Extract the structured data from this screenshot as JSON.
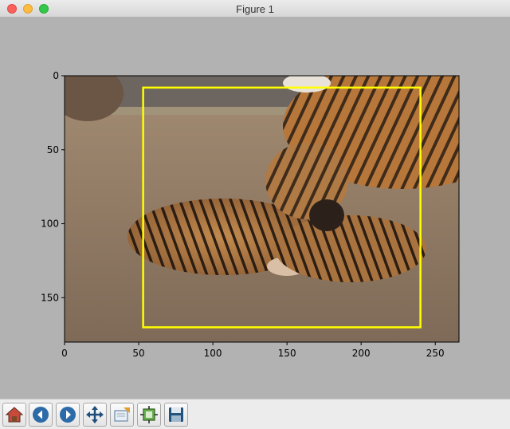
{
  "window": {
    "title": "Figure 1"
  },
  "toolbar": {
    "buttons": [
      {
        "name": "home-button",
        "icon": "home-icon"
      },
      {
        "name": "back-button",
        "icon": "back-arrow-icon"
      },
      {
        "name": "forward-button",
        "icon": "forward-arrow-icon"
      },
      {
        "name": "pan-button",
        "icon": "move-icon"
      },
      {
        "name": "zoom-button",
        "icon": "zoom-rect-icon"
      },
      {
        "name": "configure-subplots-button",
        "icon": "subplots-icon"
      },
      {
        "name": "save-button",
        "icon": "floppy-disk-icon"
      }
    ]
  },
  "chart_data": {
    "type": "image",
    "image": "photo of tiger cubs lying on floor with adult tiger in background",
    "xlim": [
      0,
      266
    ],
    "ylim": [
      180,
      0
    ],
    "xticks": [
      0,
      50,
      100,
      150,
      200,
      250
    ],
    "yticks": [
      0,
      50,
      100,
      150
    ],
    "grid": false,
    "annotations": [
      {
        "type": "rectangle",
        "x0": 53,
        "y0": 8,
        "x1": 240,
        "y1": 170,
        "color": "#ffff00"
      }
    ]
  }
}
